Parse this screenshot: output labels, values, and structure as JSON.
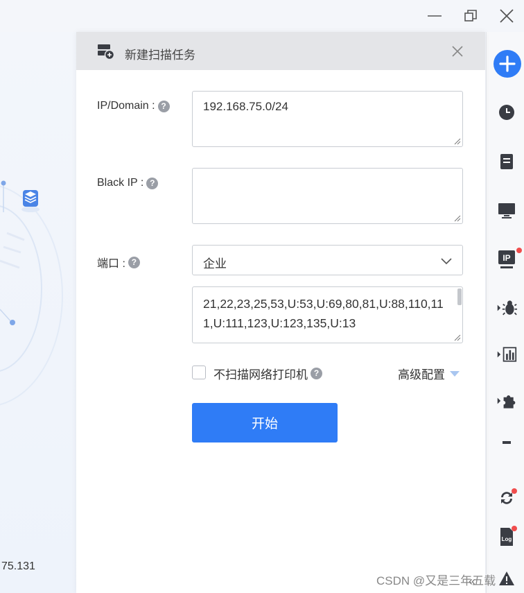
{
  "window": {
    "minimize_icon": "minimize-icon",
    "restore_icon": "restore-icon",
    "close_icon": "close-icon"
  },
  "background": {
    "ip_fragment": "75.131"
  },
  "dialog": {
    "title": "新建扫描任务",
    "title_icon": "task-add-icon",
    "ip_domain": {
      "label": "IP/Domain :",
      "value": "192.168.75.0/24"
    },
    "black_ip": {
      "label": "Black IP :",
      "value": ""
    },
    "port": {
      "label": "端口 :",
      "selected": "企业",
      "list": "21,22,23,25,53,U:53,U:69,80,81,U:88,110,111,U:111,123,U:123,135,U:13"
    },
    "skip_printer_label": "不扫描网络打印机",
    "advanced_label": "高级配置",
    "start_label": "开始"
  },
  "sidebar": {
    "items": [
      {
        "icon": "plus-icon"
      },
      {
        "icon": "clock-icon"
      },
      {
        "icon": "server-icon"
      },
      {
        "icon": "monitor-icon"
      },
      {
        "icon": "ip-icon",
        "label": "IP"
      },
      {
        "icon": "bug-icon"
      },
      {
        "icon": "chart-icon"
      },
      {
        "icon": "plugin-icon"
      },
      {
        "icon": "refresh-icon"
      },
      {
        "icon": "log-icon",
        "label": "Log"
      },
      {
        "icon": "warning-icon"
      }
    ]
  },
  "watermark": "CSDN @又是三年五载",
  "colors": {
    "accent": "#2f7cf6",
    "badge": "#f04d4d"
  }
}
